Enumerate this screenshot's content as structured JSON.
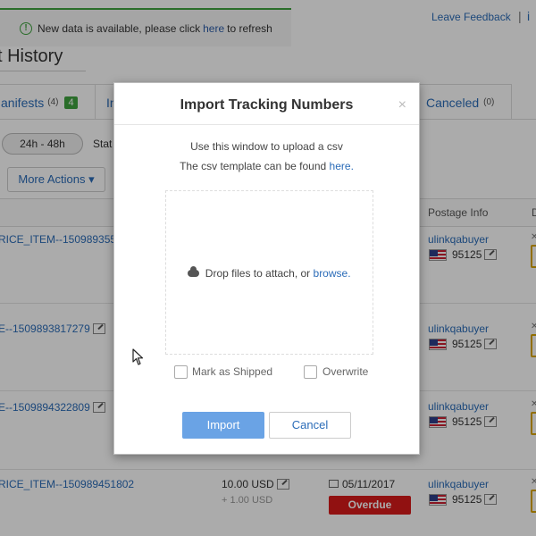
{
  "notification": {
    "info_glyph": "!",
    "text_before": "New data is available, please click",
    "link": "here",
    "text_after": "to refresh"
  },
  "feedback": {
    "label": "Leave Feedback",
    "separator": "|"
  },
  "page": {
    "title": "t History"
  },
  "tabs": {
    "manifests": {
      "label": "anifests",
      "count": "(4)",
      "badge": "4"
    },
    "in": {
      "label": "In"
    },
    "canceled": {
      "label": "Canceled",
      "count": "(0)"
    }
  },
  "filters": {
    "time_range": "24h - 48h",
    "status_label": "Stat",
    "more_actions": "More Actions ▾"
  },
  "table": {
    "headers": {
      "postage_info": "Postage Info",
      "d": "D"
    },
    "rows": [
      {
        "item": "RICE_ITEM--150989355",
        "buyer": "ulinkqabuyer",
        "zip": "95125"
      },
      {
        "item": "E--1509893817279",
        "buyer": "ulinkqabuyer",
        "zip": "95125"
      },
      {
        "item": "E--1509894322809",
        "buyer": "ulinkqabuyer",
        "zip": "95125"
      },
      {
        "item": "RICE_ITEM--150989451802",
        "buyer": "ulinkqabuyer",
        "zip": "95125",
        "price": "10.00 USD",
        "price_sub": "+ 1.00 USD",
        "date": "05/11/2017",
        "status": "Overdue"
      }
    ]
  },
  "modal": {
    "title": "Import Tracking Numbers",
    "close": "×",
    "line1": "Use this window to upload a csv",
    "line2_before": "The csv template can be found",
    "line2_link": "here.",
    "drop_before": "Drop files to attach, or",
    "drop_link": "browse.",
    "mark_shipped": "Mark as Shipped",
    "overwrite": "Overwrite",
    "import_button": "Import",
    "cancel_button": "Cancel"
  },
  "colors": {
    "link": "#2b6cb8",
    "success": "#3fa33f",
    "overdue": "#d81a1a",
    "primary_button": "#6aa3e5"
  }
}
